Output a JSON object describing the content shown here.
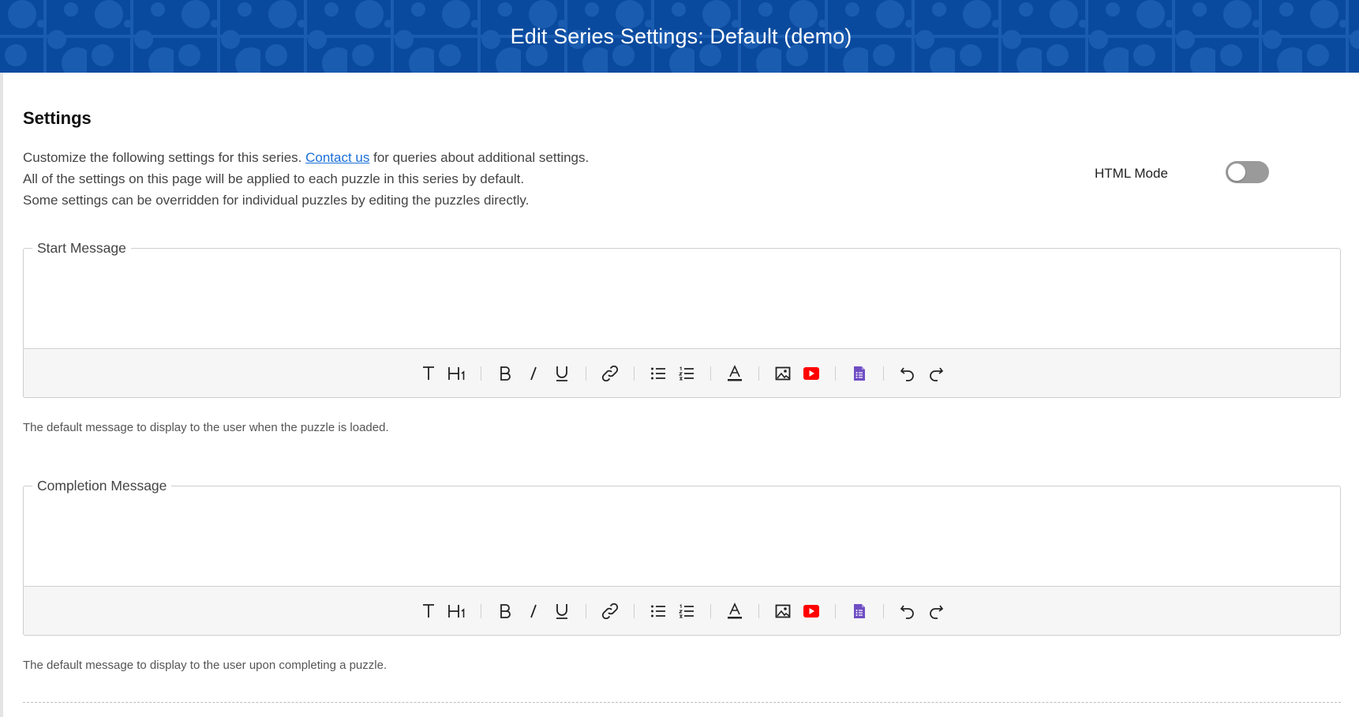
{
  "header": {
    "title": "Edit Series Settings: Default (demo)",
    "background_color": "#0a4a9e"
  },
  "settings": {
    "title": "Settings",
    "description": {
      "line1_before_link": "Customize the following settings for this series.",
      "link_text": "Contact us",
      "line1_after_link": "for queries about additional settings.",
      "line2": "All of the settings on this page will be applied to each puzzle in this series by default.",
      "line3": "Some settings can be overridden for individual puzzles by editing the puzzles directly."
    },
    "html_mode": {
      "label": "HTML Mode",
      "enabled": false
    }
  },
  "start_message": {
    "legend": "Start Message",
    "value": "",
    "help": "The default message to display to the user when the puzzle is loaded."
  },
  "completion_message": {
    "legend": "Completion Message",
    "value": "",
    "help": "The default message to display to the user upon completing a puzzle."
  },
  "toolbar": {
    "icons": [
      "text-icon",
      "heading-icon",
      "bold-icon",
      "italic-icon",
      "underline-icon",
      "link-icon",
      "bullet-list-icon",
      "numbered-list-icon",
      "text-color-icon",
      "image-icon",
      "youtube-icon",
      "google-form-icon",
      "undo-icon",
      "redo-icon"
    ],
    "youtube_color": "#ff0000",
    "form_color": "#6f4ec4"
  }
}
